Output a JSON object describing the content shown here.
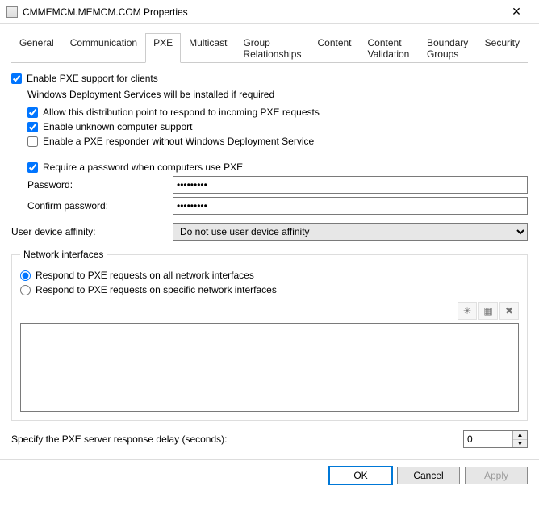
{
  "window": {
    "title": "CMMEMCM.MEMCM.COM Properties"
  },
  "tabs": [
    "General",
    "Communication",
    "PXE",
    "Multicast",
    "Group Relationships",
    "Content",
    "Content Validation",
    "Boundary Groups",
    "Security"
  ],
  "active_tab_index": 2,
  "pxe": {
    "enable_label": "Enable PXE support for clients",
    "enable_checked": true,
    "wds_note": "Windows Deployment Services will be installed if required",
    "allow_respond_label": "Allow this distribution point to respond to incoming PXE requests",
    "allow_respond_checked": true,
    "unknown_support_label": "Enable unknown computer support",
    "unknown_support_checked": true,
    "responder_no_wds_label": "Enable a PXE responder without Windows Deployment Service",
    "responder_no_wds_checked": false,
    "require_password_label": "Require a password when computers use PXE",
    "require_password_checked": true,
    "password_label": "Password:",
    "password_value": "•••••••••",
    "confirm_label": "Confirm password:",
    "confirm_value": "•••••••••",
    "affinity_label": "User device affinity:",
    "affinity_value": "Do not use user device affinity",
    "network_group_label": "Network interfaces",
    "radio_all_label": "Respond to PXE requests on all network interfaces",
    "radio_specific_label": "Respond to PXE requests on specific network interfaces",
    "radio_selected": "all",
    "delay_label": "Specify the PXE server response delay (seconds):",
    "delay_value": "0"
  },
  "buttons": {
    "ok": "OK",
    "cancel": "Cancel",
    "apply": "Apply"
  }
}
